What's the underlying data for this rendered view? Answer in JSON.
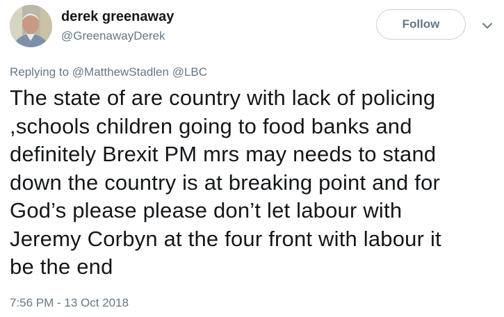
{
  "author": {
    "name": "derek greenaway",
    "handle": "@GreenawayDerek"
  },
  "follow_button": {
    "label": "Follow"
  },
  "caret_icon": "chevron-down-icon",
  "reply": {
    "prefix": "Replying to",
    "mentions": [
      "@MatthewStadlen",
      "@LBC"
    ]
  },
  "tweet": {
    "lines": [
      "The state of are country with lack of policing",
      ",schools children going to food banks and",
      "definitely Brexit PM mrs may needs to stand",
      "down the country is at breaking point and for",
      "God’s please please don’t let labour with",
      "Jeremy Corbyn at the four front with labour it",
      "be the end"
    ]
  },
  "timestamp": "7:56 PM - 13 Oct 2018",
  "colors": {
    "text": "#14171a",
    "secondary": "#657786",
    "border": "#c8cfd5"
  }
}
